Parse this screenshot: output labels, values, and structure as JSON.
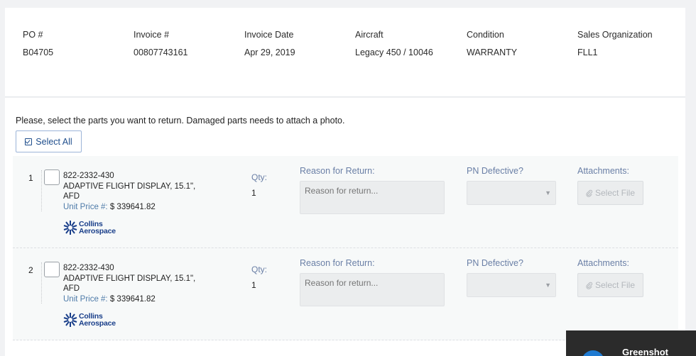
{
  "header": {
    "po_label": "PO #",
    "po_value": "B04705",
    "invoice_label": "Invoice #",
    "invoice_value": "00807743161",
    "invoice_date_label": "Invoice Date",
    "invoice_date_value": "Apr 29, 2019",
    "aircraft_label": "Aircraft",
    "aircraft_value": "Legacy 450 / 10046",
    "condition_label": "Condition",
    "condition_value": "WARRANTY",
    "sales_org_label": "Sales Organization",
    "sales_org_value": "FLL1"
  },
  "instruction": "Please, select the parts you want to return. Damaged parts needs to attach a photo.",
  "select_all_label": "Select All",
  "parts": [
    {
      "index": "1",
      "part_number": "822-2332-430",
      "description": "ADAPTIVE FLIGHT DISPLAY, 15.1\", AFD",
      "unit_price_label": "Unit Price #:",
      "unit_price": "$ 339641.82",
      "brand_line1": "Collins",
      "brand_line2": "Aerospace",
      "qty_label": "Qty:",
      "qty_value": "1",
      "reason_label": "Reason for Return:",
      "reason_placeholder": "Reason for return...",
      "pn_defective_label": "PN Defective?",
      "pn_defective_value": "",
      "attachments_label": "Attachments:",
      "select_file_label": "Select File"
    },
    {
      "index": "2",
      "part_number": "822-2332-430",
      "description": "ADAPTIVE FLIGHT DISPLAY, 15.1\", AFD",
      "unit_price_label": "Unit Price #:",
      "unit_price": "$ 339641.82",
      "brand_line1": "Collins",
      "brand_line2": "Aerospace",
      "qty_label": "Qty:",
      "qty_value": "1",
      "reason_label": "Reason for Return:",
      "reason_placeholder": "Reason for return...",
      "pn_defective_label": "PN Defective?",
      "pn_defective_value": "",
      "attachments_label": "Attachments:",
      "select_file_label": "Select File"
    }
  ],
  "notification": {
    "app_name": "Greenshot"
  },
  "colors": {
    "accent": "#1f4e8c",
    "label": "#6a7fa6",
    "brand": "#1a3f8a"
  }
}
